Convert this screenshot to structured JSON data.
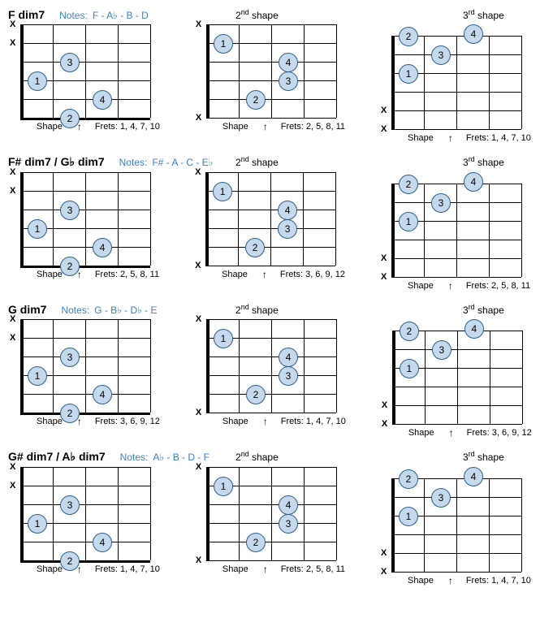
{
  "rows": [
    {
      "chord": "F dim7",
      "notes_label": "Notes:",
      "notes": "F - A♭ - B - D",
      "shape2_label": "2",
      "shape3_label": "3",
      "shape_suffix": "shape",
      "diagrams": [
        {
          "mutes": [
            0,
            1
          ],
          "thick_bottom": true,
          "arrow_col": 1,
          "dots": [
            {
              "str": 3,
              "fret": 0,
              "n": "1"
            },
            {
              "str": 5,
              "fret": 1,
              "n": "2"
            },
            {
              "str": 2,
              "fret": 1,
              "n": "3"
            },
            {
              "str": 4,
              "fret": 2,
              "n": "4"
            }
          ],
          "frets": "Frets: 1, 4, 7, 10"
        },
        {
          "mutes": [
            0,
            5
          ],
          "thick_bottom": false,
          "arrow_col": 1,
          "dots": [
            {
              "str": 1,
              "fret": 0,
              "n": "1"
            },
            {
              "str": 4,
              "fret": 1,
              "n": "2"
            },
            {
              "str": 3,
              "fret": 2,
              "n": "3"
            },
            {
              "str": 2,
              "fret": 2,
              "n": "4"
            }
          ],
          "frets": "Frets: 2, 5, 8, 11"
        },
        {
          "mutes": [
            4,
            5
          ],
          "thick_bottom": false,
          "arrow_col": 1,
          "dots": [
            {
              "str": 2,
              "fret": 0,
              "n": "1"
            },
            {
              "str": 0,
              "fret": 0,
              "n": "2"
            },
            {
              "str": 1,
              "fret": 1,
              "n": "3"
            },
            {
              "str": 0,
              "fret": 2,
              "n": "4",
              "above": true
            }
          ],
          "frets": "Frets: 1, 4, 7, 10"
        }
      ]
    },
    {
      "chord": "F# dim7 / G♭ dim7",
      "notes_label": "Notes:",
      "notes": "F# - A - C - E♭",
      "shape2_label": "2",
      "shape3_label": "3",
      "shape_suffix": "shape",
      "diagrams": [
        {
          "mutes": [
            0,
            1
          ],
          "thick_bottom": true,
          "arrow_col": 1,
          "dots": [
            {
              "str": 3,
              "fret": 0,
              "n": "1"
            },
            {
              "str": 5,
              "fret": 1,
              "n": "2"
            },
            {
              "str": 2,
              "fret": 1,
              "n": "3"
            },
            {
              "str": 4,
              "fret": 2,
              "n": "4"
            }
          ],
          "frets": "Frets: 2, 5, 8, 11"
        },
        {
          "mutes": [
            0,
            5
          ],
          "thick_bottom": false,
          "arrow_col": 1,
          "dots": [
            {
              "str": 1,
              "fret": 0,
              "n": "1"
            },
            {
              "str": 4,
              "fret": 1,
              "n": "2"
            },
            {
              "str": 3,
              "fret": 2,
              "n": "3"
            },
            {
              "str": 2,
              "fret": 2,
              "n": "4"
            }
          ],
          "frets": "Frets: 3, 6, 9, 12"
        },
        {
          "mutes": [
            4,
            5
          ],
          "thick_bottom": false,
          "arrow_col": 1,
          "dots": [
            {
              "str": 2,
              "fret": 0,
              "n": "1"
            },
            {
              "str": 0,
              "fret": 0,
              "n": "2"
            },
            {
              "str": 1,
              "fret": 1,
              "n": "3"
            },
            {
              "str": 0,
              "fret": 2,
              "n": "4",
              "above": true
            }
          ],
          "frets": "Frets: 2, 5, 8, 11"
        }
      ]
    },
    {
      "chord": "G dim7",
      "notes_label": "Notes:",
      "notes": "G - B♭ - D♭ - E",
      "shape2_label": "2",
      "shape3_label": "3",
      "shape_suffix": "shape",
      "diagrams": [
        {
          "mutes": [
            0,
            1
          ],
          "thick_bottom": true,
          "arrow_col": 1,
          "dots": [
            {
              "str": 3,
              "fret": 0,
              "n": "1"
            },
            {
              "str": 5,
              "fret": 1,
              "n": "2"
            },
            {
              "str": 2,
              "fret": 1,
              "n": "3"
            },
            {
              "str": 4,
              "fret": 2,
              "n": "4"
            }
          ],
          "frets": "Frets: 3, 6, 9, 12"
        },
        {
          "mutes": [
            0,
            5
          ],
          "thick_bottom": false,
          "arrow_col": 1,
          "dots": [
            {
              "str": 1,
              "fret": 0,
              "n": "1"
            },
            {
              "str": 4,
              "fret": 1,
              "n": "2"
            },
            {
              "str": 3,
              "fret": 2,
              "n": "3"
            },
            {
              "str": 2,
              "fret": 2,
              "n": "4"
            }
          ],
          "frets": "Frets: 1, 4, 7, 10"
        },
        {
          "mutes": [
            4,
            5
          ],
          "thick_bottom": false,
          "arrow_col": 1,
          "dots": [
            {
              "str": 2,
              "fret": 0,
              "n": "1"
            },
            {
              "str": 0,
              "fret": 0,
              "n": "2"
            },
            {
              "str": 1,
              "fret": 1,
              "n": "3"
            },
            {
              "str": 0,
              "fret": 2,
              "n": "4",
              "above": true
            }
          ],
          "frets": "Frets: 3, 6, 9, 12"
        }
      ]
    },
    {
      "chord": "G# dim7 / A♭ dim7",
      "notes_label": "Notes:",
      "notes": "A♭ - B - D - F",
      "shape2_label": "2",
      "shape3_label": "3",
      "shape_suffix": "shape",
      "diagrams": [
        {
          "mutes": [
            0,
            1
          ],
          "thick_bottom": true,
          "arrow_col": 1,
          "dots": [
            {
              "str": 3,
              "fret": 0,
              "n": "1"
            },
            {
              "str": 5,
              "fret": 1,
              "n": "2"
            },
            {
              "str": 2,
              "fret": 1,
              "n": "3"
            },
            {
              "str": 4,
              "fret": 2,
              "n": "4"
            }
          ],
          "frets": "Frets: 1, 4, 7, 10"
        },
        {
          "mutes": [
            0,
            5
          ],
          "thick_bottom": false,
          "arrow_col": 1,
          "dots": [
            {
              "str": 1,
              "fret": 0,
              "n": "1"
            },
            {
              "str": 4,
              "fret": 1,
              "n": "2"
            },
            {
              "str": 3,
              "fret": 2,
              "n": "3"
            },
            {
              "str": 2,
              "fret": 2,
              "n": "4"
            }
          ],
          "frets": "Frets: 2, 5, 8, 11"
        },
        {
          "mutes": [
            4,
            5
          ],
          "thick_bottom": false,
          "arrow_col": 1,
          "dots": [
            {
              "str": 2,
              "fret": 0,
              "n": "1"
            },
            {
              "str": 0,
              "fret": 0,
              "n": "2"
            },
            {
              "str": 1,
              "fret": 1,
              "n": "3"
            },
            {
              "str": 0,
              "fret": 2,
              "n": "4",
              "above": true
            }
          ],
          "frets": "Frets: 1, 4, 7, 10"
        }
      ]
    }
  ],
  "labels": {
    "shape": "Shape",
    "ord2": "nd",
    "ord3": "rd"
  }
}
